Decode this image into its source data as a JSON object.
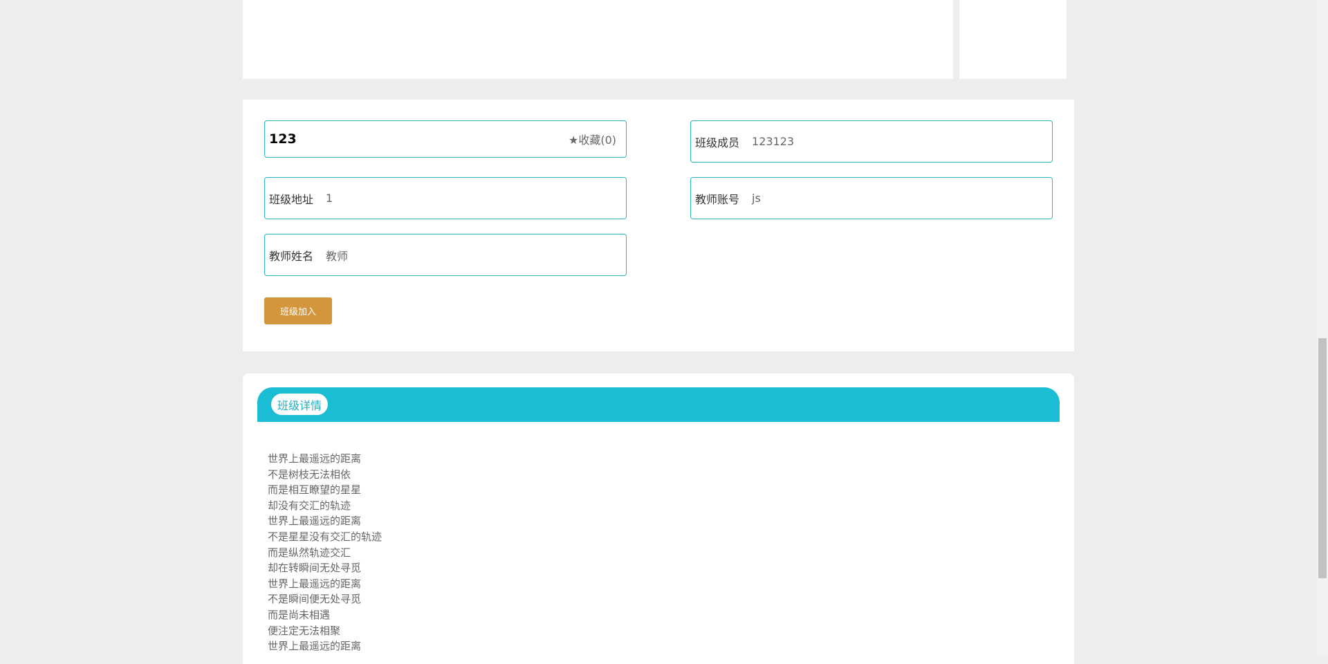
{
  "class_info": {
    "name": "123",
    "favorite_label": "收藏(0)",
    "fields": [
      {
        "label": "班级成员",
        "value": "123123"
      },
      {
        "label": "班级地址",
        "value": "1"
      },
      {
        "label": "教师账号",
        "value": "js"
      },
      {
        "label": "教师姓名",
        "value": "教师"
      }
    ],
    "join_button": "班级加入"
  },
  "details": {
    "tab_label": "班级详情",
    "lines": [
      "世界上最遥远的距离",
      "不是树枝无法相依",
      "而是相互瞭望的星星",
      "却没有交汇的轨迹",
      "世界上最遥远的距离",
      "不是星星没有交汇的轨迹",
      "而是纵然轨迹交汇",
      "却在转瞬间无处寻觅",
      "世界上最遥远的距离",
      "不是瞬间便无处寻觅",
      "而是尚未相遇",
      "便注定无法相聚",
      "世界上最遥远的距离"
    ]
  },
  "colors": {
    "accent": "#1bbdd4",
    "button": "#d4963a",
    "border": "#2bb3c0"
  }
}
